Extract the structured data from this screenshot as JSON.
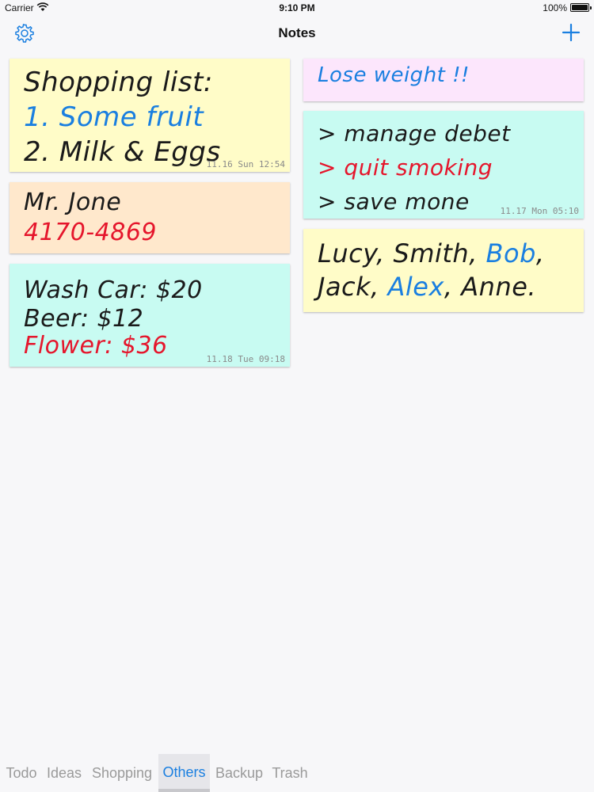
{
  "status_bar": {
    "carrier": "Carrier",
    "time": "9:10 PM",
    "battery": "100%",
    "battery_level": 1.0
  },
  "nav": {
    "title": "Notes",
    "settings_icon": "gear-icon",
    "add_icon": "plus-icon",
    "accent": "#1a7fe0"
  },
  "notes": {
    "shopping": {
      "color": "#fffcc8",
      "lines": [
        "Shopping list:",
        "1. Some fruit",
        "2. Milk & Eggs"
      ],
      "timestamp": "11.16 Sun 12:54"
    },
    "jone": {
      "color": "#ffe8cc",
      "lines": [
        "Mr. Jone",
        "4170-4869"
      ]
    },
    "expenses": {
      "color": "#c8fbf2",
      "lines": [
        "Wash Car: $20",
        "Beer: $12",
        "Flower: $36"
      ],
      "timestamp": "11.18 Tue 09:18"
    },
    "weight": {
      "color": "#fce6fc",
      "lines": [
        "Lose weight !!"
      ]
    },
    "tasks": {
      "color": "#c8fbf2",
      "lines": [
        "> manage debet",
        "> quit smoking",
        "> save mone"
      ],
      "timestamp": "11.17 Mon 05:10"
    },
    "names": {
      "color": "#fffcc8",
      "line1": [
        "Lucy, Smith, ",
        "Bob",
        ","
      ],
      "line2": [
        "Jack, ",
        "Alex",
        ", Anne."
      ]
    }
  },
  "tabs": [
    {
      "label": "Todo",
      "active": false
    },
    {
      "label": "Ideas",
      "active": false
    },
    {
      "label": "Shopping",
      "active": false
    },
    {
      "label": "Others",
      "active": true
    },
    {
      "label": "Backup",
      "active": false
    },
    {
      "label": "Trash",
      "active": false
    }
  ]
}
